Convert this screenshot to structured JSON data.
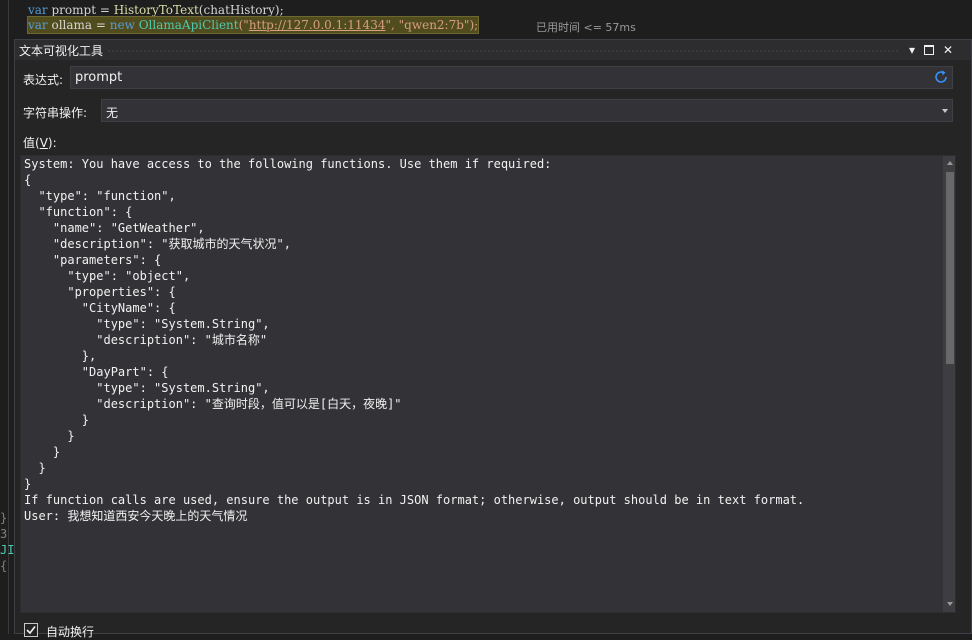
{
  "editor": {
    "line1": {
      "kw": "var",
      "rest": " prompt = ",
      "fn": "HistoryToText",
      "args": "(chatHistory);"
    },
    "line2": {
      "kw1": "var",
      "mid1": " ollama = ",
      "kw2": "new",
      "sp": " ",
      "type": "OllamaApiClient",
      "open": "(\"",
      "url": "http://127.0.0.1:11434",
      "comma": "\", \"",
      "model": "qwen2:7b",
      "close": "\");"
    },
    "perf_tip": "已用时间 <= 57ms",
    "gutter_glyphs": [
      "}",
      "3",
      "JI",
      "{"
    ]
  },
  "dialog": {
    "title": "文本可视化工具",
    "title_buttons": {
      "dropdown": "▾",
      "maximize": "",
      "close": "✕"
    },
    "expression_label_pre": "表达式",
    "expression_label_post": ":",
    "expression_value": "prompt",
    "string_op_label": "字符串操作:",
    "string_op_value": "无",
    "value_label_pre": "值(",
    "value_label_key": "V",
    "value_label_post": "):",
    "value_text": "System: You have access to the following functions. Use them if required:\n{\n  \"type\": \"function\",\n  \"function\": {\n    \"name\": \"GetWeather\",\n    \"description\": \"获取城市的天气状况\",\n    \"parameters\": {\n      \"type\": \"object\",\n      \"properties\": {\n        \"CityName\": {\n          \"type\": \"System.String\",\n          \"description\": \"城市名称\"\n        },\n        \"DayPart\": {\n          \"type\": \"System.String\",\n          \"description\": \"查询时段，值可以是[白天，夜晚]\"\n        }\n      }\n    }\n  }\n}\nIf function calls are used, ensure the output is in JSON format; otherwise, output should be in text format.\nUser: 我想知道西安今天晚上的天气情况",
    "word_wrap_label": "自动换行",
    "word_wrap_checked": true
  },
  "colors": {
    "dialog_bg": "#252526",
    "input_bg": "#333337",
    "highlight_line": "#514c1e",
    "keyword": "#569cd6",
    "type": "#4ec9b0",
    "string": "#d69d85",
    "refresh_icon": "#3794ff"
  },
  "icons": [
    "refresh-icon",
    "chevron-down-icon",
    "close-icon",
    "maximize-icon",
    "checkmark-icon"
  ]
}
